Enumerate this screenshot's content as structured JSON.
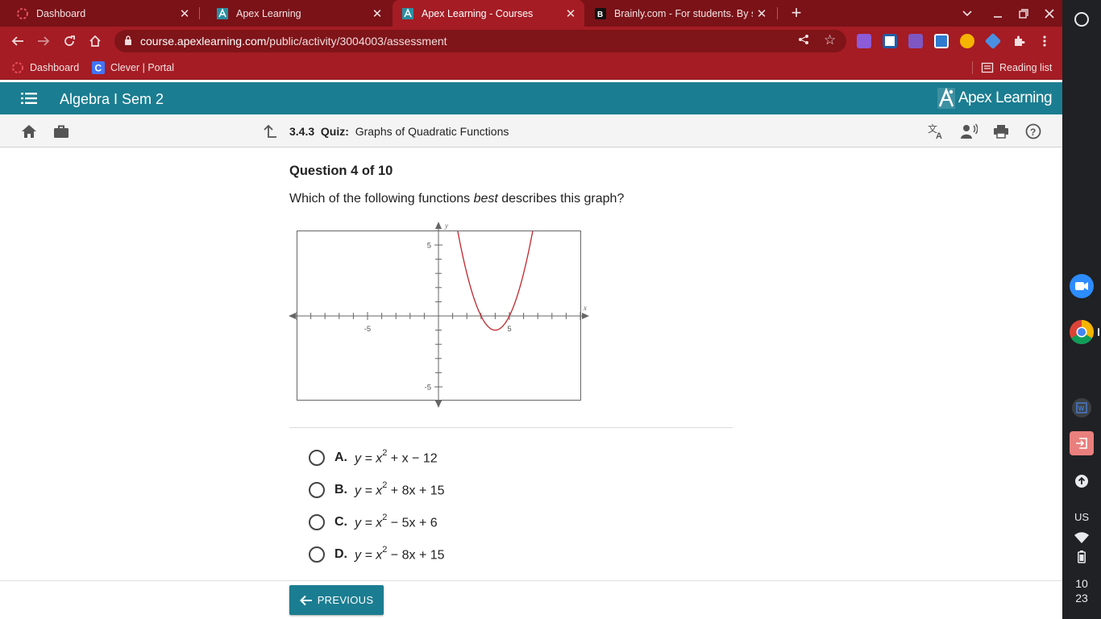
{
  "browser": {
    "tabs": [
      {
        "title": "Dashboard",
        "icon": "loading-ring-icon",
        "active": false
      },
      {
        "title": "Apex Learning",
        "icon": "apex-favicon-icon",
        "active": false
      },
      {
        "title": "Apex Learning - Courses",
        "icon": "apex-favicon-icon",
        "active": true
      },
      {
        "title": "Brainly.com - For students. By students.",
        "icon": "brainly-favicon-icon",
        "active": false
      }
    ],
    "url_host": "course.apexlearning.com",
    "url_path": "/public/activity/3004003/assessment",
    "bookmarks": [
      {
        "label": "Dashboard"
      },
      {
        "label": "Clever | Portal"
      }
    ],
    "reading_list": "Reading list",
    "colors": {
      "frame": "#7a1218",
      "toolbar": "#a51c24"
    }
  },
  "apex": {
    "course_title": "Algebra I Sem 2",
    "logo_text": "Apex Learning",
    "quiz_number": "3.4.3",
    "quiz_label": "Quiz:",
    "quiz_name": "Graphs of Quadratic Functions",
    "accent_color": "#1b7d91"
  },
  "question": {
    "number": "Question 4 of 10",
    "prompt_before": "Which of the following functions ",
    "prompt_emph": "best",
    "prompt_after": " describes this graph?"
  },
  "chart_data": {
    "type": "line",
    "x_axis_label": "x",
    "y_axis_label": "y",
    "tick_labels": {
      "x": [
        "-5",
        "5"
      ],
      "y": [
        "5",
        "-5"
      ]
    },
    "xlim": [
      -10,
      10
    ],
    "ylim": [
      -6,
      6
    ],
    "series": [
      {
        "function": "x^2 - 8x + 15",
        "vertex": [
          4,
          -1
        ],
        "x_intercepts": [
          3,
          5
        ],
        "color": "#c0262c"
      }
    ]
  },
  "options": [
    {
      "letter": "A.",
      "pre": "y = x",
      "exp": "2",
      "post": " + x − 12"
    },
    {
      "letter": "B.",
      "pre": "y = x",
      "exp": "2",
      "post": " + 8x + 15"
    },
    {
      "letter": "C.",
      "pre": "y = x",
      "exp": "2",
      "post": " − 5x + 6"
    },
    {
      "letter": "D.",
      "pre": "y = x",
      "exp": "2",
      "post": " − 8x + 15"
    }
  ],
  "footer": {
    "previous_label": "PREVIOUS"
  },
  "shelf": {
    "language": "US",
    "clock_hour": "10",
    "clock_minute": "23"
  }
}
